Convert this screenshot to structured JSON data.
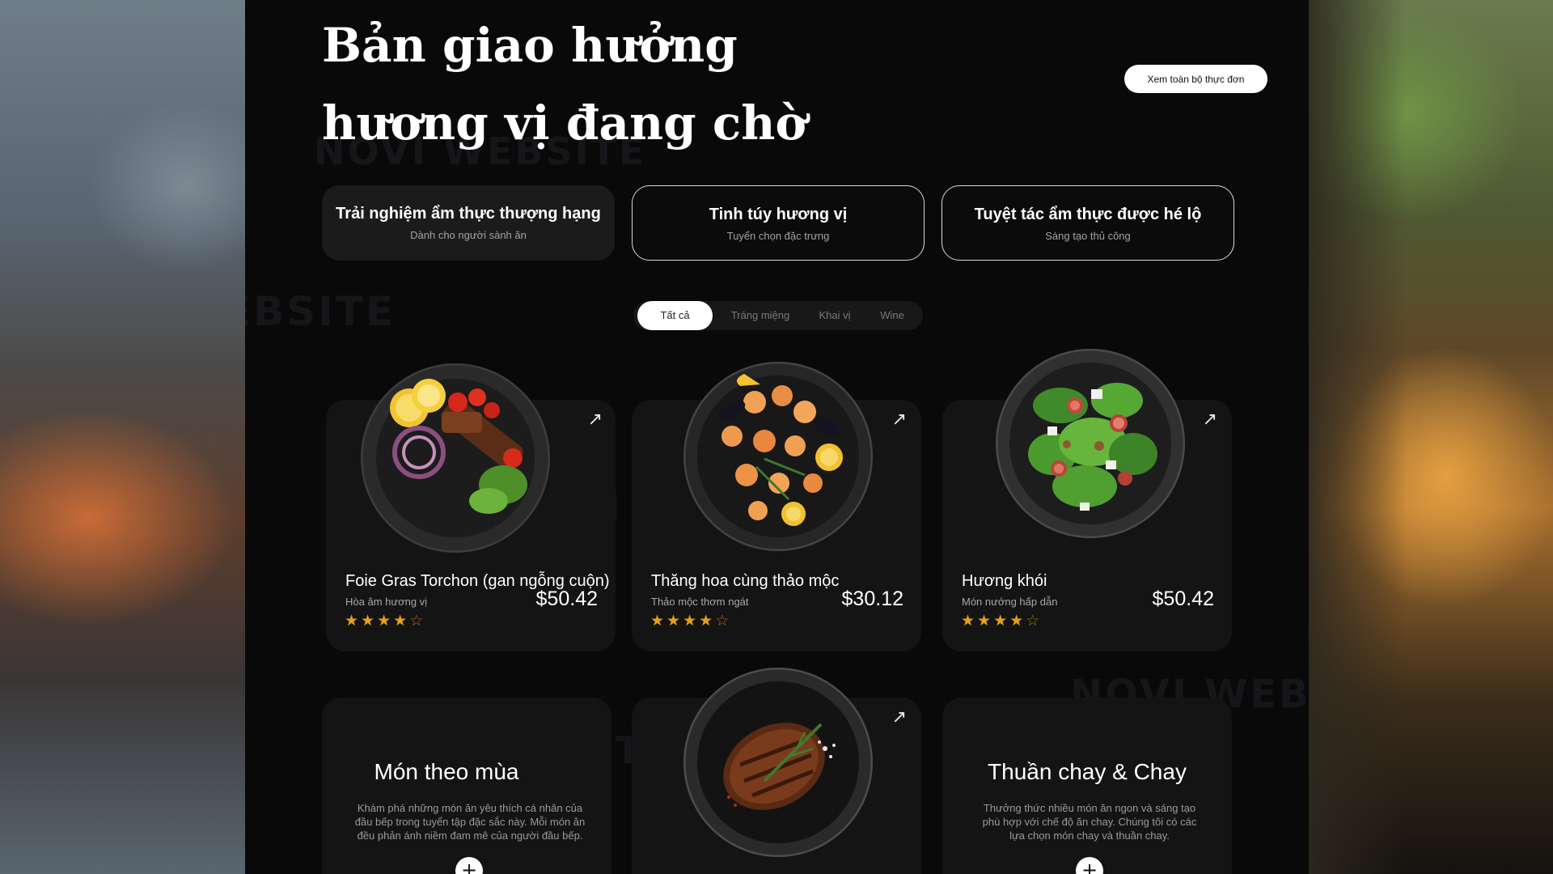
{
  "hero": {
    "title": "Bản giao hưởng hương vị đang chờ",
    "view_menu_button": "Xem toàn bộ thực đơn"
  },
  "watermark": {
    "brand": "NOVI",
    "suffix": "WEBSITE"
  },
  "features": [
    {
      "title": "Trải nghiệm ẩm thực thượng hạng",
      "subtitle": "Dành cho người sành ăn"
    },
    {
      "title": "Tinh túy hương vị",
      "subtitle": "Tuyển chọn đặc trưng"
    },
    {
      "title": "Tuyệt tác ẩm thực được hé lộ",
      "subtitle": "Sáng tạo thủ công"
    }
  ],
  "filters": {
    "items": [
      "Tất cả",
      "Tráng miệng",
      "Khai vị",
      "Wine"
    ],
    "selected": "Tất cả"
  },
  "dishes": [
    {
      "name": "Foie Gras Torchon (gan ngỗng cuộn)",
      "subtitle": "Hòa âm hương vị",
      "price": "$50.42",
      "rating": 4.5,
      "image": "grilled-skewer-plate"
    },
    {
      "name": "Thăng hoa cùng thảo mộc",
      "subtitle": "Thảo mộc thơm ngát",
      "price": "$30.12",
      "rating": 4.5,
      "image": "seafood-shrimp-plate"
    },
    {
      "name": "Hương khói",
      "subtitle": "Món nướng hấp dẫn",
      "price": "$50.42",
      "rating": 4.5,
      "image": "fig-salad-plate"
    }
  ],
  "promos": {
    "seasonal": {
      "title": "Món theo mùa",
      "description": "Khám phá những món ăn yêu thích cá nhân của đầu bếp trong tuyển tập đặc sắc này. Mỗi món ăn đều phản ánh niềm đam mê của người đầu bếp."
    },
    "vegan": {
      "title": "Thuần chay & Chay",
      "description": "Thưởng thức nhiều món ăn ngon và sáng tạo phù hợp với chế độ ăn chay. Chúng tôi có các lựa chọn món chay và thuần chay."
    },
    "featured_image": "grilled-steak-plate"
  },
  "icons": {
    "arrow": "arrow-up-right-icon",
    "plus": "plus-icon",
    "star": "star-icon"
  },
  "colors": {
    "page_bg": "#090909",
    "card_bg": "#141414",
    "star": "#e3a21a"
  }
}
